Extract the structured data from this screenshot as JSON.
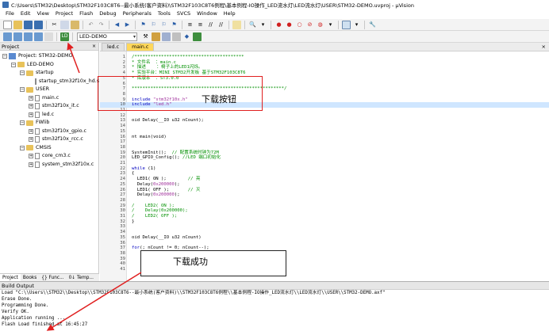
{
  "window": {
    "title": "C:\\Users\\STM32\\Desktop\\STM32F103C8T6--最小系统(客户资料)\\STM32F103C8T6例程\\基本例程-IO操作_LED流水灯\\LED流水灯\\USER\\STM32-DEMO.uvproj - µVision"
  },
  "menu": [
    "File",
    "Edit",
    "View",
    "Project",
    "Flash",
    "Debug",
    "Peripherals",
    "Tools",
    "SVCS",
    "Window",
    "Help"
  ],
  "toolbar": {
    "target_name": "LED-DEMO"
  },
  "project_panel": {
    "title": "Project",
    "close": "×",
    "tree": [
      {
        "label": "Project: STM32-DEMO",
        "kind": "project",
        "level": 0,
        "expander": "−"
      },
      {
        "label": "LED-DEMO",
        "kind": "folder",
        "level": 1,
        "expander": "−"
      },
      {
        "label": "startup",
        "kind": "folder",
        "level": 2,
        "expander": "−"
      },
      {
        "label": "startup_stm32f10x_hd.s",
        "kind": "file",
        "level": 3,
        "expander": ""
      },
      {
        "label": "USER",
        "kind": "folder",
        "level": 2,
        "expander": "−"
      },
      {
        "label": "main.c",
        "kind": "file",
        "level": 3,
        "expander": "+"
      },
      {
        "label": "stm32f10x_it.c",
        "kind": "file",
        "level": 3,
        "expander": "+"
      },
      {
        "label": "led.c",
        "kind": "file",
        "level": 3,
        "expander": "+"
      },
      {
        "label": "FWlib",
        "kind": "folder",
        "level": 2,
        "expander": "−"
      },
      {
        "label": "stm32f10x_gpio.c",
        "kind": "file",
        "level": 3,
        "expander": "+"
      },
      {
        "label": "stm32f10x_rcc.c",
        "kind": "file",
        "level": 3,
        "expander": "+"
      },
      {
        "label": "CMSIS",
        "kind": "folder",
        "level": 2,
        "expander": "−"
      },
      {
        "label": "core_cm3.c",
        "kind": "file",
        "level": 3,
        "expander": "+"
      },
      {
        "label": "system_stm32f10x.c",
        "kind": "file",
        "level": 3,
        "expander": "+"
      }
    ],
    "tabs": [
      "Project",
      "Books",
      "{} Func...",
      "0↓ Temp..."
    ]
  },
  "editor": {
    "tabs": [
      {
        "label": "led.c",
        "active": false
      },
      {
        "label": "main.c",
        "active": true
      }
    ],
    "close": "×",
    "lines": [
      {
        "n": "1",
        "text": "/*****************************************"
      },
      {
        "n": "2",
        "text": "* 文件名  ：main.c"
      },
      {
        "n": "3",
        "text": "* 描述    ：椅子上的LED1闪烁。"
      },
      {
        "n": "4",
        "text": "* 实验平台：MINI STM32开发板 基于STM32F103C8T6"
      },
      {
        "n": "5",
        "text": "* 库版本  ：ST3.0.0"
      },
      {
        "n": "6",
        "text": ""
      },
      {
        "n": "7",
        "text": "*********************************************************/"
      },
      {
        "n": "8",
        "text": ""
      },
      {
        "n": "9",
        "text": "include \"stm32f10x.h\""
      },
      {
        "n": "10",
        "text": "include \"led.h\""
      },
      {
        "n": "11",
        "text": ""
      },
      {
        "n": "12",
        "text": ""
      },
      {
        "n": "13",
        "text": "oid Delay(__IO u32 nCount);"
      },
      {
        "n": "14",
        "text": ""
      },
      {
        "n": "15",
        "text": ""
      },
      {
        "n": "16",
        "text": "nt main(void)"
      },
      {
        "n": "17",
        "text": ""
      },
      {
        "n": "18",
        "text": ""
      },
      {
        "n": "19",
        "text": "SystemInit();  // 配置系统时钟为72M"
      },
      {
        "n": "20",
        "text": "LED_GPIO_Config(); //LED 端口初始化"
      },
      {
        "n": "21",
        "text": ""
      },
      {
        "n": "22",
        "text": "while (1)"
      },
      {
        "n": "23",
        "text": "{"
      },
      {
        "n": "24",
        "text": "  LED1( ON );        // 亮"
      },
      {
        "n": "25",
        "text": "  Delay(0x200000);"
      },
      {
        "n": "26",
        "text": "  LED1( OFF );       // 灭"
      },
      {
        "n": "27",
        "text": "  Delay(0x200000);"
      },
      {
        "n": "28",
        "text": ""
      },
      {
        "n": "29",
        "text": "/    LED2( ON );"
      },
      {
        "n": "30",
        "text": "/    Delay(0x200000);"
      },
      {
        "n": "31",
        "text": "/    LED2( OFF );"
      },
      {
        "n": "32",
        "text": "}"
      },
      {
        "n": "33",
        "text": ""
      },
      {
        "n": "34",
        "text": ""
      },
      {
        "n": "35",
        "text": "oid Delay(__IO u32 nCount)"
      },
      {
        "n": "36",
        "text": ""
      },
      {
        "n": "37",
        "text": "for(; nCount != 0; nCount--);"
      },
      {
        "n": "38",
        "text": ""
      },
      {
        "n": "39",
        "text": ""
      },
      {
        "n": "40",
        "text": ""
      },
      {
        "n": "41",
        "text": ""
      }
    ]
  },
  "annotations": {
    "download_button_label": "下载按钮",
    "download_success_label": "下载成功"
  },
  "build_output": {
    "title": "Build Output",
    "lines": [
      "Load \"C:\\\\Users\\\\STM32\\\\Desktop\\\\STM32F103C8T6--最小系统(客户资料)\\\\STM32F103C8T6例程\\\\基本例程-IO操作_LED流水灯\\\\LED流水灯\\\\USER\\\\STM32-DEMO.axf\"",
      "Erase Done.",
      "Programming Done.",
      "Verify OK.",
      "Application running ...",
      "Flash Load finished at 16:45:27"
    ]
  },
  "colors": {
    "annotation_red": "#e02020",
    "comment_green": "#009000",
    "string_purple": "#a0309c",
    "keyword_blue": "#0000c0",
    "active_tab": "#ffd75a"
  }
}
